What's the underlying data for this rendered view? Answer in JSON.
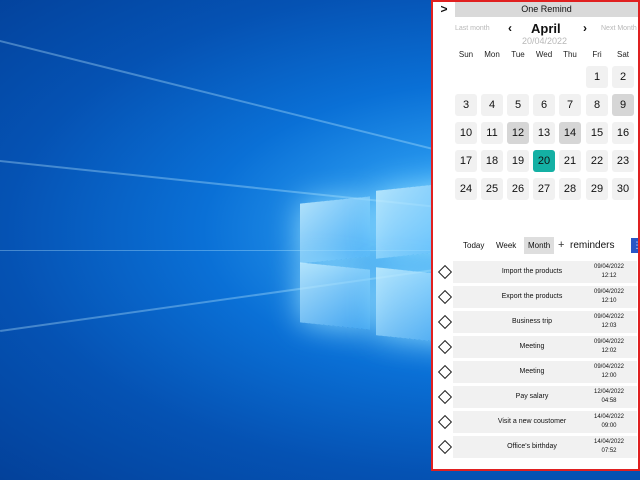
{
  "app": {
    "collapse_icon": "chevron-right-icon",
    "collapse_glyph": ">",
    "title": "One Remind"
  },
  "calendar": {
    "last_month_label": "Last month",
    "next_month_label": "Next Month",
    "prev_arrow": "‹",
    "next_arrow": "›",
    "month": "April",
    "selected_date": "20/04/2022",
    "weekdays": [
      "Sun",
      "Mon",
      "Tue",
      "Wed",
      "Thu",
      "Fri",
      "Sat"
    ],
    "weeks": [
      [
        "",
        "",
        "",
        "",
        "",
        "1",
        "2"
      ],
      [
        "3",
        "4",
        "5",
        "6",
        "7",
        "8",
        "9"
      ],
      [
        "10",
        "11",
        "12",
        "13",
        "14",
        "15",
        "16"
      ],
      [
        "17",
        "18",
        "19",
        "20",
        "21",
        "22",
        "23"
      ],
      [
        "24",
        "25",
        "26",
        "27",
        "28",
        "29",
        "30"
      ]
    ],
    "marked_days": [
      "9",
      "12",
      "14"
    ],
    "selected_day": "20",
    "accent_color": "#14b0a4"
  },
  "tabs": {
    "today": "Today",
    "week": "Week",
    "month": "Month",
    "active": "Month",
    "add_glyph": "+",
    "reminders_label": "reminders"
  },
  "reminders": [
    {
      "title": "Import the products",
      "date": "09/04/2022",
      "time": "12:12"
    },
    {
      "title": "Export the  products",
      "date": "09/04/2022",
      "time": "12:10"
    },
    {
      "title": "Business trip",
      "date": "09/04/2022",
      "time": "12:03"
    },
    {
      "title": "Meeting",
      "date": "09/04/2022",
      "time": "12:02"
    },
    {
      "title": "Meeting",
      "date": "09/04/2022",
      "time": "12:00"
    },
    {
      "title": "Pay salary",
      "date": "12/04/2022",
      "time": "04:58"
    },
    {
      "title": "Visit a new coustomer",
      "date": "14/04/2022",
      "time": "09:00"
    },
    {
      "title": "Office's birthday",
      "date": "14/04/2022",
      "time": "07:52"
    }
  ]
}
